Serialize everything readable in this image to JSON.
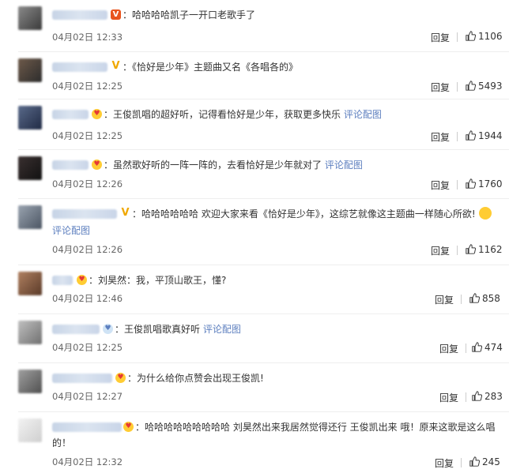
{
  "comments": [
    {
      "text": "哈哈哈哈凯子一开口老歌手了",
      "link": "",
      "time": "04月02日 12:33",
      "reply": "回复",
      "likes": "1106"
    },
    {
      "text": "《恰好是少年》主题曲又名《各唱各的》",
      "link": "",
      "time": "04月02日 12:25",
      "reply": "回复",
      "likes": "5493"
    },
    {
      "text": "王俊凯唱的超好听，记得看恰好是少年，获取更多快乐",
      "link": "评论配图",
      "time": "04月02日 12:25",
      "reply": "回复",
      "likes": "1944"
    },
    {
      "text": "虽然歌好听的一阵一阵的，去看恰好是少年就对了",
      "link": "评论配图",
      "time": "04月02日 12:26",
      "reply": "回复",
      "likes": "1760"
    },
    {
      "text": "哈哈哈哈哈哈 欢迎大家来看《恰好是少年》，这综艺就像这主题曲一样随心所欲!",
      "link": "评论配图",
      "time": "04月02日 12:26",
      "reply": "回复",
      "likes": "1162"
    },
    {
      "text": "刘昊然：我，平顶山歌王，懂?",
      "link": "",
      "time": "04月02日 12:46",
      "reply": "回复",
      "likes": "858"
    },
    {
      "text": "王俊凯唱歌真好听",
      "link": "评论配图",
      "time": "04月02日 12:25",
      "reply": "回复",
      "likes": "474"
    },
    {
      "text": "为什么给你点赞会出现王俊凯!",
      "link": "",
      "time": "04月02日 12:27",
      "reply": "回复",
      "likes": "283"
    },
    {
      "text_line1": "哈哈哈哈哈哈哈哈哈 刘昊然出来我居然觉得还行 王俊凯出来 哦！原来这歌是这么唱",
      "text_line2": "的！",
      "link": "",
      "time": "04月02日 12:32",
      "reply": "回复",
      "likes": "245"
    }
  ]
}
